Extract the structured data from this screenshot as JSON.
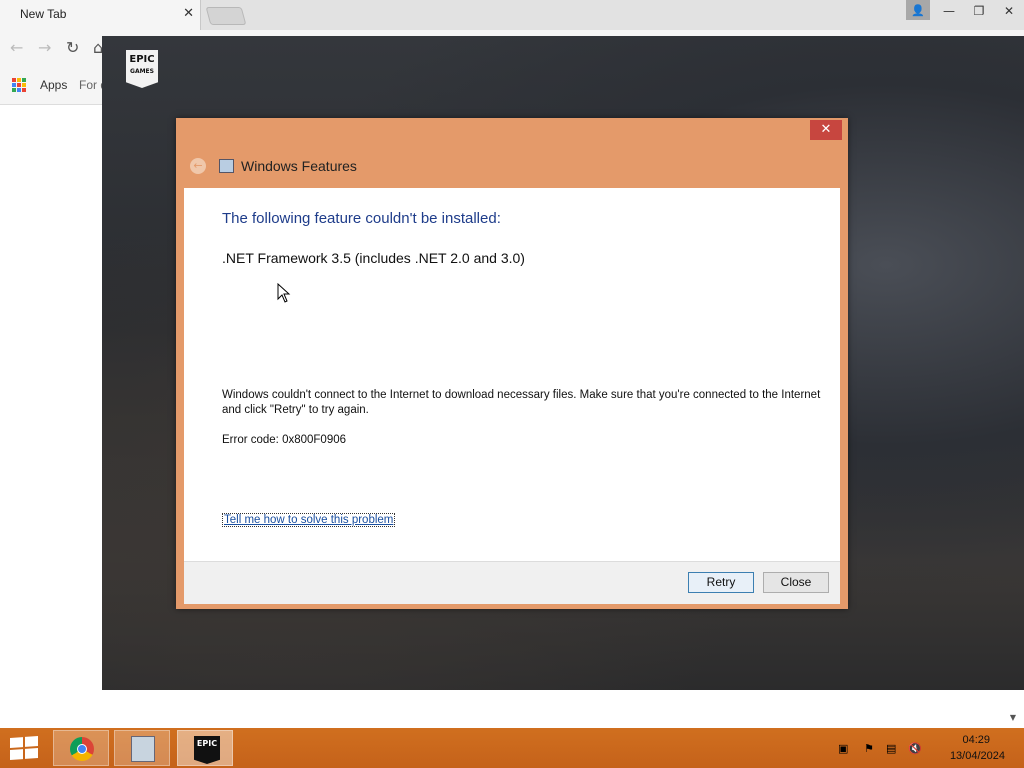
{
  "browser": {
    "tab_title": "New Tab",
    "tab_close": "✕",
    "bookmarks": {
      "apps_label": "Apps",
      "partial_label": "For q"
    }
  },
  "dialog": {
    "title": "Windows Features",
    "heading": "The following feature couldn't be installed:",
    "feature": ".NET Framework 3.5 (includes .NET 2.0 and 3.0)",
    "message": "Windows couldn't connect to the Internet to download necessary files. Make sure that you're connected to the Internet and click \"Retry\" to try again.",
    "error_code": "Error code: 0x800F0906",
    "help_link": "Tell me how to solve this problem",
    "retry_label": "Retry",
    "close_label": "Close",
    "accent_color": "#e49a6a"
  },
  "taskbar": {
    "time": "04:29",
    "date": "13/04/2024",
    "items": [
      "chrome-icon",
      "windows-features-icon",
      "epic-games-icon"
    ],
    "color": "#c8651c"
  },
  "epic": {
    "logo_text": "EPIC",
    "logo_sub": "GAMES"
  }
}
